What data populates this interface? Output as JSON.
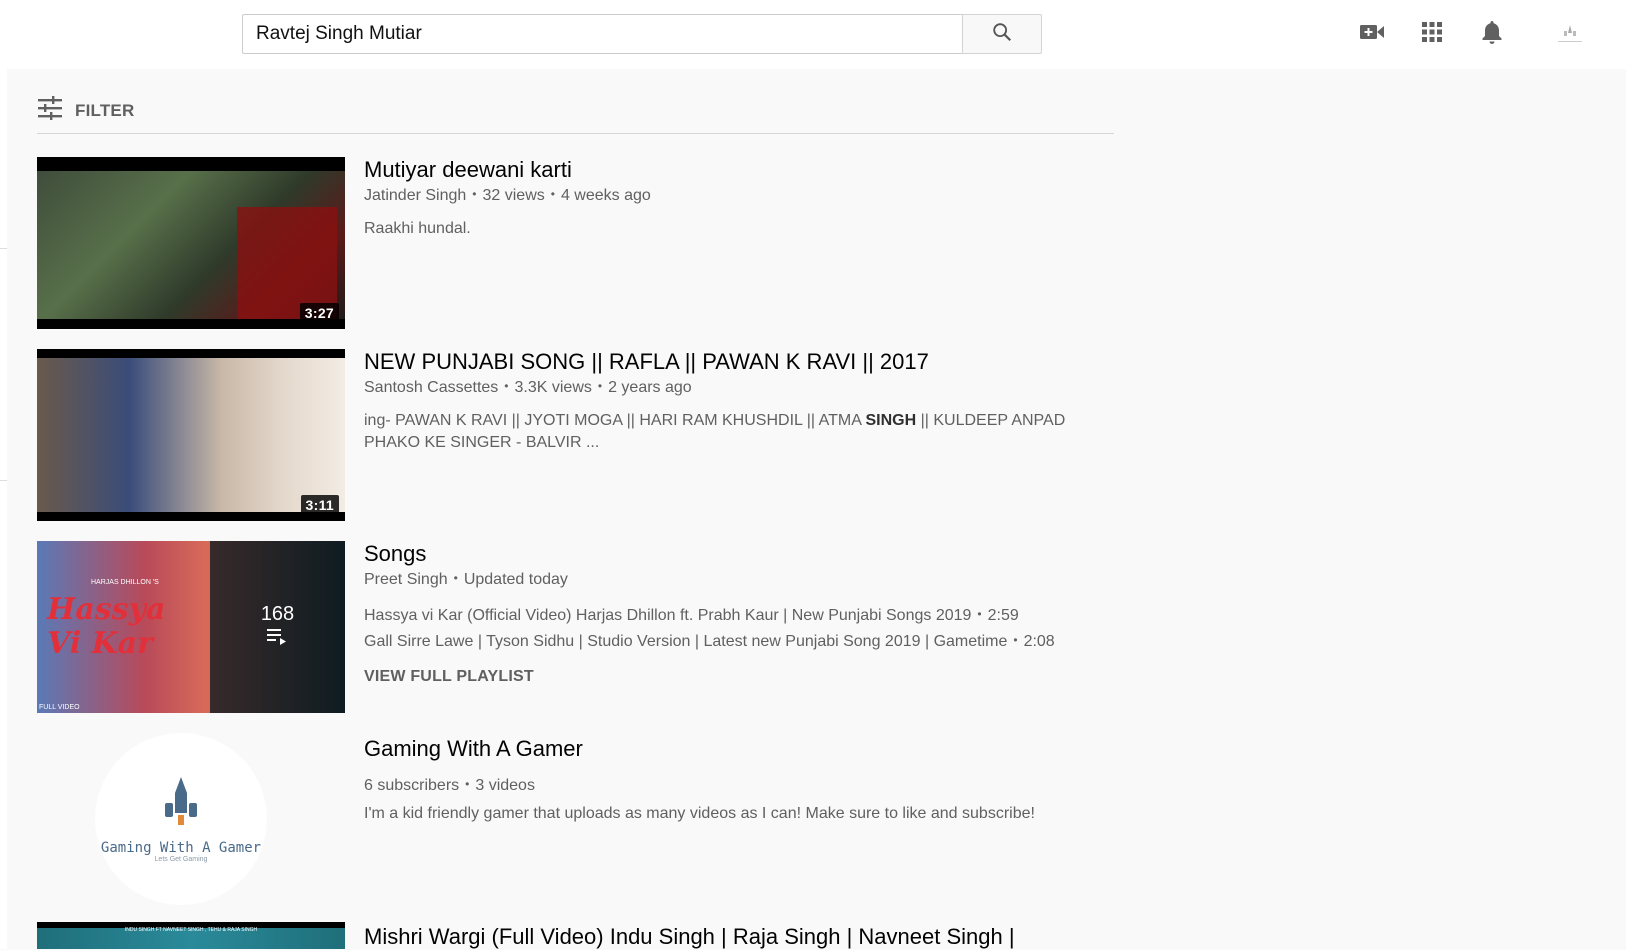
{
  "search": {
    "value": "Ravtej Singh Mutiar",
    "placeholder": "Search"
  },
  "header_icons": [
    "create-video-icon",
    "apps-grid-icon",
    "notifications-bell-icon",
    "account-avatar"
  ],
  "filter": {
    "label": "FILTER"
  },
  "results": [
    {
      "type": "video",
      "title": "Mutiyar deewani karti",
      "channel": "Jatinder Singh",
      "views": "32 views",
      "age": "4 weeks ago",
      "description": "Raakhi hundal.",
      "duration": "3:27"
    },
    {
      "type": "video",
      "title": "NEW PUNJABI SONG || RAFLA || PAWAN K RAVI || 2017",
      "channel": "Santosh Cassettes",
      "views": "3.3K views",
      "age": "2 years ago",
      "description_before": "ing- PAWAN K RAVI || JYOTI MOGA || HARI RAM KHUSHDIL || ATMA ",
      "description_bold": "SINGH",
      "description_after": " || KULDEEP ANPAD PHAKO KE SINGER - BALVIR ...",
      "duration": "3:11"
    },
    {
      "type": "playlist",
      "title": "Songs",
      "channel": "Preet Singh",
      "updated": "Updated today",
      "video_count": "168",
      "thumb_text_1": "Hassya",
      "thumb_text_2": "Vi Kar",
      "thumb_small_top": "HARJAS DHILLON 'S",
      "thumb_small_bottom": "FULL VIDEO",
      "items": [
        {
          "title": "Hassya vi Kar (Official Video) Harjas Dhillon ft. Prabh Kaur | New Punjabi Songs 2019",
          "duration": "2:59"
        },
        {
          "title": "Gall Sirre Lawe | Tyson Sidhu | Studio Version | Latest new Punjabi Song 2019 | Gametime",
          "duration": "2:08"
        }
      ],
      "view_full": "VIEW FULL PLAYLIST"
    },
    {
      "type": "channel",
      "title": "Gaming With A Gamer",
      "subscribers": "6 subscribers",
      "videos": "3 videos",
      "description": "I'm a kid friendly gamer that uploads as many videos as I can! Make sure to like and subscribe!",
      "logo_text": "Gaming With A Gamer",
      "logo_tagline": "Lets Get Gaming"
    },
    {
      "type": "video",
      "title": "Mishri Wargi (Full Video) Indu Singh | Raja Singh | Navneet Singh |",
      "thumb_text": "INDU SINGH FT NAVNEET SINGH , TEHU & RAJA SINGH"
    }
  ],
  "colors": {
    "background": "#f9f9f9",
    "text_primary": "#030303",
    "text_secondary": "#606060"
  }
}
